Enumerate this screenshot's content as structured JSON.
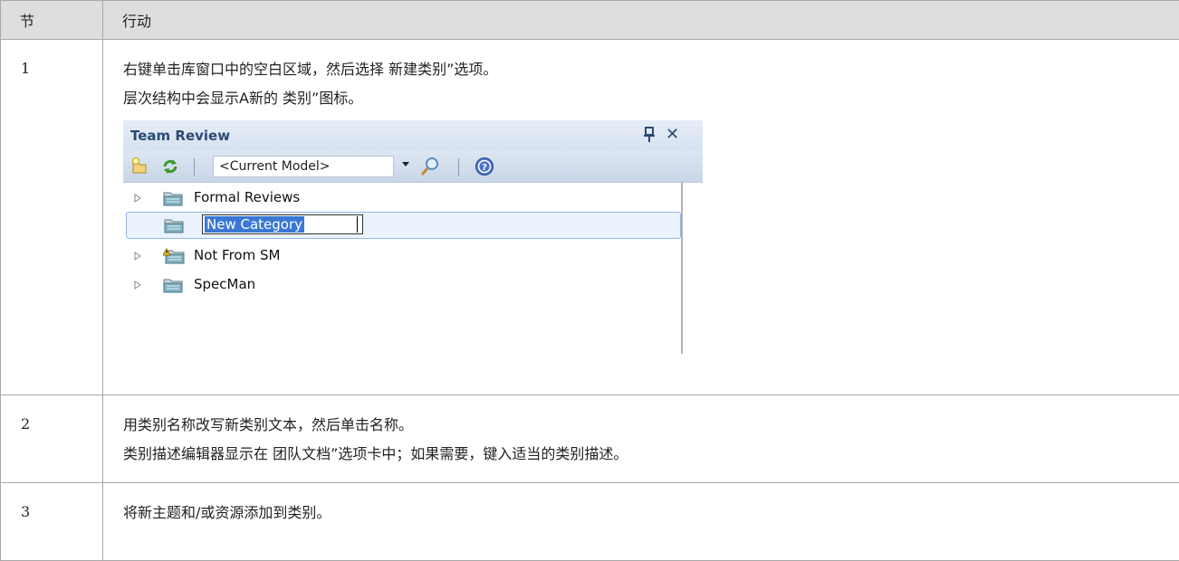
{
  "table": {
    "headers": [
      "节",
      "行动"
    ],
    "rows": [
      {
        "step": "1",
        "lines": [
          "右键单击库窗口中的空白区域，然后选择 新建类别”选项。",
          "层次结构中会显示A新的 类别”图标。"
        ]
      },
      {
        "step": "2",
        "lines": [
          "用类别名称改写新类别文本，然后单击名称。",
          "类别描述编辑器显示在 团队文档”选项卡中；如果需要，键入适当的类别描述。"
        ]
      },
      {
        "step": "3",
        "lines": [
          "将新主题和/或资源添加到类别。"
        ]
      }
    ]
  },
  "panel": {
    "title": "Team Review",
    "model_select": "<Current Model>",
    "tree": [
      {
        "label": "Formal Reviews",
        "icon": "folder-icon",
        "expandable": true
      },
      {
        "label": "New Category",
        "icon": "folder-icon",
        "expandable": false,
        "editing": true
      },
      {
        "label": "Not From SM",
        "icon": "folder-warning-icon",
        "expandable": true
      },
      {
        "label": "SpecMan",
        "icon": "folder-icon",
        "expandable": true
      }
    ]
  },
  "colors": {
    "header_bg": "#dedede",
    "border": "#a8a8a8",
    "panel_title": "#2b4a74",
    "selection": "#3a78d4"
  }
}
